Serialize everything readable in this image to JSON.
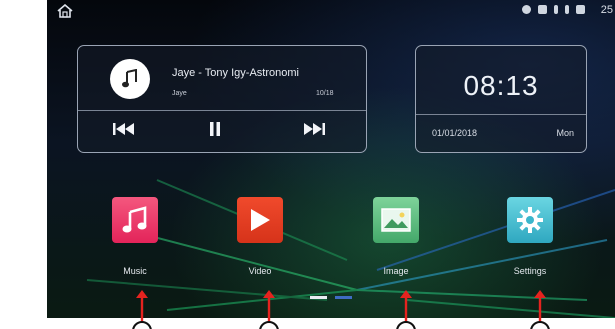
{
  "status_bar": {
    "right_text": "25"
  },
  "music": {
    "title": "Jaye - Tony Igy-Astronomi",
    "artist": "Jaye",
    "track_count": "10/18"
  },
  "clock": {
    "time": "08:13",
    "date": "01/01/2018",
    "day": "Mon"
  },
  "apps": [
    {
      "label": "Music",
      "icon": "music-note-icon",
      "color": "#e8336a"
    },
    {
      "label": "Video",
      "icon": "play-icon",
      "color": "#e03a20"
    },
    {
      "label": "Image",
      "icon": "picture-icon",
      "color": "#56b879"
    },
    {
      "label": "Settings",
      "icon": "gear-icon",
      "color": "#3bb6cc"
    }
  ],
  "pager": {
    "active_page": 1,
    "page_count": 2
  },
  "annotation_color": "#e5231f"
}
